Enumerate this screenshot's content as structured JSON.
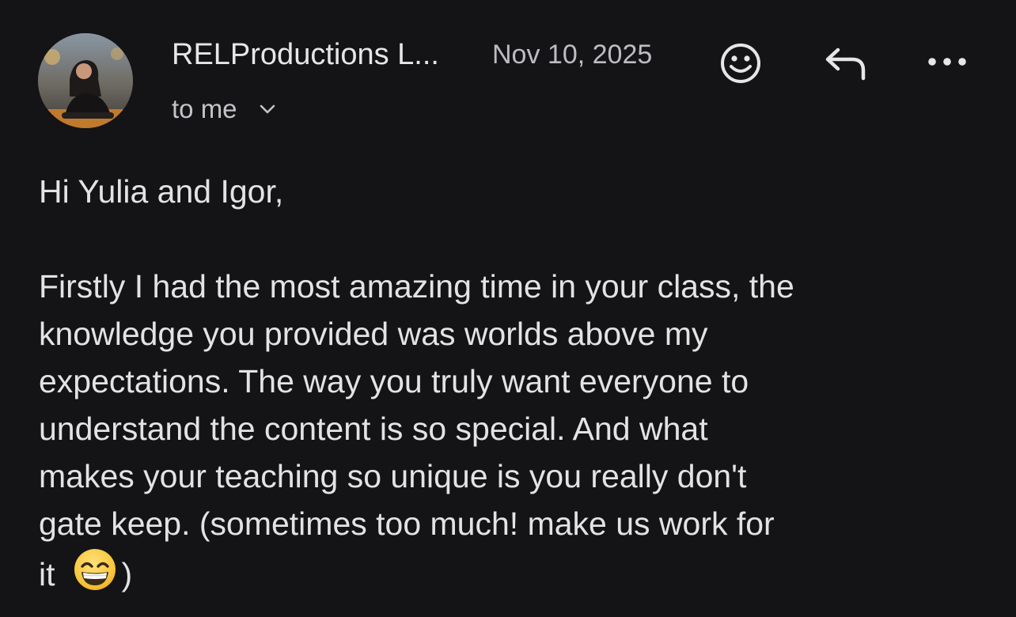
{
  "header": {
    "sender_name": "RELProductions L...",
    "date": "Nov 10, 2025",
    "recipient_label": "to me",
    "icons": {
      "avatar": "sender-photo",
      "recipient_toggle": "chevron-down-icon",
      "react": "smiley-icon",
      "reply": "reply-arrow-icon",
      "more": "more-dots-icon"
    }
  },
  "message": {
    "greeting": "Hi Yulia and Igor,",
    "lines": [
      "Firstly I had the most amazing time in your class, the",
      "knowledge you provided was worlds above my",
      "expectations. The way you truly want everyone to",
      "understand the content is so special. And what",
      "makes your teaching so unique is you really don't",
      "gate keep. (sometimes too much! make us work for"
    ],
    "last_line_start": "it",
    "last_line_end": ")",
    "inline_emoji": "grinning-face-emoji"
  },
  "colors": {
    "background": "#141416",
    "text": "#e3e3e5",
    "secondary_text": "#bdbdc1"
  }
}
